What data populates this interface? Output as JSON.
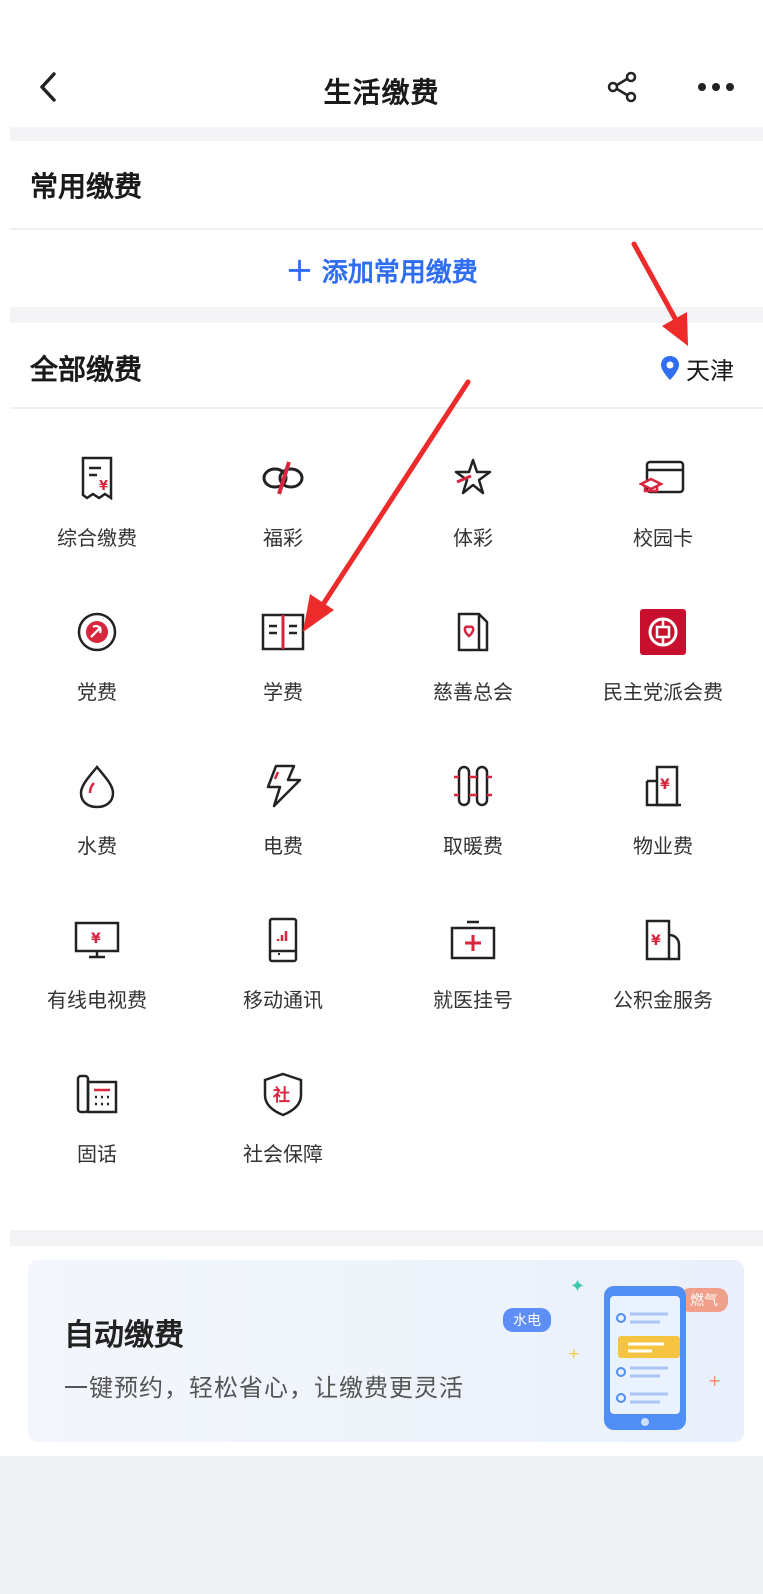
{
  "nav": {
    "title": "生活缴费",
    "back_icon": "back-chevron-icon",
    "share_icon": "share-icon",
    "more_icon": "more-dots-icon"
  },
  "common": {
    "title": "常用缴费",
    "add_label": "添加常用缴费"
  },
  "all": {
    "title": "全部缴费",
    "location": "天津"
  },
  "items": [
    {
      "label": "综合缴费",
      "icon": "receipt-icon"
    },
    {
      "label": "福彩",
      "icon": "welfare-lottery-icon"
    },
    {
      "label": "体彩",
      "icon": "sports-lottery-icon"
    },
    {
      "label": "校园卡",
      "icon": "campus-card-icon"
    },
    {
      "label": "党费",
      "icon": "party-badge-icon"
    },
    {
      "label": "学费",
      "icon": "book-icon"
    },
    {
      "label": "慈善总会",
      "icon": "charity-icon"
    },
    {
      "label": "民主党派会费",
      "icon": "bank-icon"
    },
    {
      "label": "水费",
      "icon": "water-drop-icon"
    },
    {
      "label": "电费",
      "icon": "lightning-icon"
    },
    {
      "label": "取暖费",
      "icon": "radiator-icon"
    },
    {
      "label": "物业费",
      "icon": "building-icon"
    },
    {
      "label": "有线电视费",
      "icon": "tv-icon"
    },
    {
      "label": "移动通讯",
      "icon": "phone-icon"
    },
    {
      "label": "就医挂号",
      "icon": "medical-kit-icon"
    },
    {
      "label": "公积金服务",
      "icon": "fund-building-icon"
    },
    {
      "label": "固话",
      "icon": "landline-icon"
    },
    {
      "label": "社会保障",
      "icon": "shield-social-icon"
    }
  ],
  "banner": {
    "title": "自动缴费",
    "subtitle": "一键预约，轻松省心，让缴费更灵活",
    "tag_water": "水电",
    "tag_gas": "燃气"
  },
  "colors": {
    "accent": "#2f6ef3",
    "icon_red": "#d7263d",
    "arrow": "#ee2b2b"
  }
}
